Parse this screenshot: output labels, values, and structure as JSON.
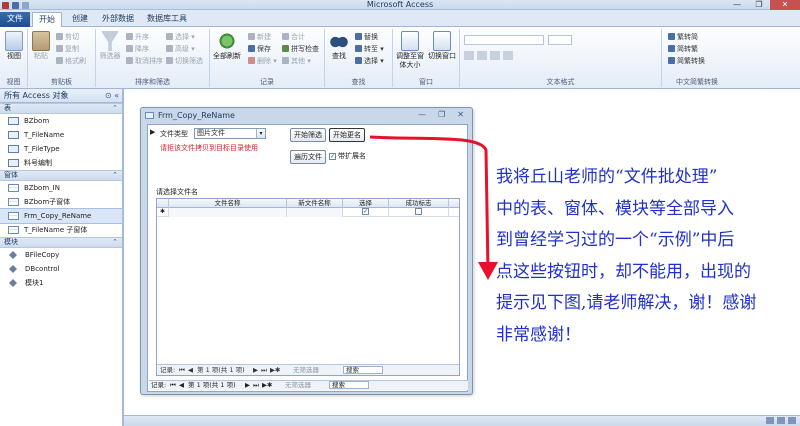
{
  "window": {
    "title": "Microsoft Access",
    "minimize": "—",
    "maximize": "❐",
    "close": "✕"
  },
  "tabs": [
    {
      "label": "文件"
    },
    {
      "label": "开始"
    },
    {
      "label": "创建"
    },
    {
      "label": "外部数据"
    },
    {
      "label": "数据库工具"
    }
  ],
  "ribbon": {
    "view": {
      "button": "视图",
      "group": "视图"
    },
    "clipboard": {
      "paste": "粘贴",
      "cut": "剪切",
      "copy": "复制",
      "format_painter": "格式刷",
      "group": "剪贴板"
    },
    "sort_filter": {
      "filter": "筛选器",
      "asc": "升序",
      "desc": "降序",
      "remove_sort": "取消排序",
      "selection": "选择",
      "advanced": "高级",
      "toggle_filter": "切换筛选",
      "group": "排序和筛选"
    },
    "records": {
      "refresh_all": "全部刷新",
      "new": "新建",
      "save": "保存",
      "delete": "删除",
      "totals": "合计",
      "spelling": "拼写检查",
      "more": "其他",
      "group": "记录"
    },
    "find": {
      "find": "查找",
      "replace": "替换",
      "goto": "转至",
      "select": "选择",
      "group": "查找"
    },
    "window": {
      "fit": "调整至窗体大小",
      "switch": "切换窗口",
      "group": "窗口"
    },
    "text_format": {
      "group": "文本格式"
    },
    "chinese": {
      "t2s": "繁转简",
      "s2t": "简转繁",
      "convert": "简繁转换",
      "group": "中文简繁转换"
    }
  },
  "nav": {
    "header": "所有 Access 对象",
    "header_ctl": "⊙ «",
    "sections": [
      {
        "label": "表",
        "items": [
          "BZbom",
          "T_FileName",
          "T_FileType",
          "料号编制"
        ]
      },
      {
        "label": "窗体",
        "items": [
          "BZbom_IN",
          "BZbom子窗体",
          "Frm_Copy_ReName",
          "T_FileName 子窗体"
        ]
      },
      {
        "label": "模块",
        "items": [
          "BFileCopy",
          "DBcontrol",
          "模块1"
        ]
      }
    ],
    "selected": "Frm_Copy_ReName",
    "chevron": "⌃"
  },
  "form": {
    "title": "Frm_Copy_ReName",
    "ctl_min": "—",
    "ctl_max": "❐",
    "ctl_close": "✕",
    "selector": "▶",
    "file_type_label": "文件类型",
    "file_type_value": "图片文件",
    "hint": "请拒该文件拷贝到目标目录使用",
    "btn_filter": "开始筛选",
    "btn_rename": "开始更名",
    "btn_traverse": "遍历文件",
    "chk_ext": "带扩展名",
    "chk_ext_checked": "✓",
    "subform_label": "请选择文件名",
    "columns": [
      "文件名称",
      "新文件名称",
      "选择",
      "成功标志"
    ],
    "new_row_marker": "✱",
    "row_check": "✓",
    "inner_nav": {
      "label": "记录:",
      "first": "⏮",
      "prev": "◀",
      "pos": "第 1 项(共 1 项)",
      "next": "▶",
      "last": "⏭",
      "new": "▶✱",
      "nofilter": "无筛选器",
      "search": "搜索"
    },
    "outer_nav": {
      "label": "记录:",
      "first": "⏮",
      "prev": "◀",
      "pos": "第 1 项(共 1 项)",
      "next": "▶",
      "last": "⏭",
      "new": "▶✱",
      "nofilter": "无筛选器",
      "search": "搜索"
    }
  },
  "annotation": {
    "lines": [
      "我将丘山老师的“文件批处理”",
      "中的表、窗体、模块等全部导入",
      "到曾经学习过的一个“示例”中后",
      "点这些按钮时，却不能用，出现的",
      "提示见下图,请老师解决，谢！感谢",
      "非常感谢！"
    ],
    "arrow_color": "#e8102a"
  }
}
